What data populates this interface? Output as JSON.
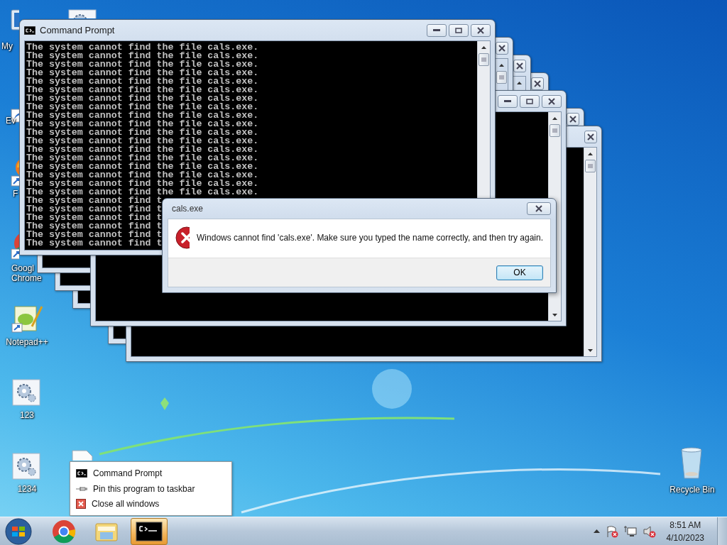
{
  "desktop_icons": [
    {
      "kind": "computer",
      "lines": [
        "My"
      ]
    },
    {
      "kind": "settings"
    },
    {
      "kind": "shortcut",
      "lines": [
        "Ev"
      ]
    },
    {
      "kind": "firefox",
      "lines": [
        "F"
      ]
    },
    {
      "kind": "chrome",
      "lines": [
        "Googl",
        "Chrome"
      ]
    },
    {
      "kind": "notepad",
      "lines": [
        "Notepad++"
      ]
    },
    {
      "kind": "settings",
      "lines": [
        "123"
      ]
    },
    {
      "kind": "settings",
      "lines": [
        "1234"
      ]
    },
    {
      "kind": "document"
    },
    {
      "kind": "recycle",
      "lines": [
        "Recycle Bin"
      ]
    }
  ],
  "console_windows": [
    {
      "kind": "console",
      "title": "Command Prompt",
      "lines": [
        "The system cannot find the file cals.exe.",
        "The system cannot find the file cals.exe.",
        "The system cannot find the file cals.exe.",
        "The system cannot find the file cals.exe.",
        "The system cannot find the file cals.exe.",
        "The system cannot find the file cals.exe.",
        "The system cannot find the file cals.exe.",
        "The system cannot find the file cals.exe.",
        "The system cannot find the file cals.exe.",
        "The system cannot find the file cals.exe.",
        "The system cannot find the file cals.exe.",
        "The system cannot find the file cals.exe.",
        "The system cannot find the file cals.exe.",
        "The system cannot find the file cals.exe.",
        "The system cannot find the file cals.exe.",
        "The system cannot find the file cals.exe.",
        "The system cannot find the file cals.exe.",
        "The system cannot find the file cals.exe.",
        "The system cannot find t",
        "The system cannot find t",
        "The system cannot find t",
        "The system cannot find t",
        "The system cannot find t",
        "The system cannot find t"
      ]
    },
    {
      "kind": "console"
    },
    {
      "kind": "console"
    },
    {
      "kind": "console"
    },
    {
      "kind": "console"
    },
    {
      "kind": "console"
    },
    {
      "kind": "console"
    }
  ],
  "dialog": {
    "title": "cals.exe",
    "message": "Windows cannot find 'cals.exe'. Make sure you typed the name correctly, and then try again.",
    "button": "OK"
  },
  "jump_list": {
    "items": [
      {
        "kind": "program",
        "label": "Command Prompt"
      },
      {
        "kind": "pin",
        "label": "Pin this program to taskbar"
      },
      {
        "kind": "close",
        "label": "Close all windows"
      }
    ]
  },
  "taskbar": {
    "buttons": [
      {
        "kind": "chrome",
        "selected": false
      },
      {
        "kind": "explorer",
        "selected": false
      },
      {
        "kind": "console",
        "selected": true
      }
    ],
    "clock": {
      "time": "8:51 AM",
      "date": "4/10/2023"
    }
  }
}
